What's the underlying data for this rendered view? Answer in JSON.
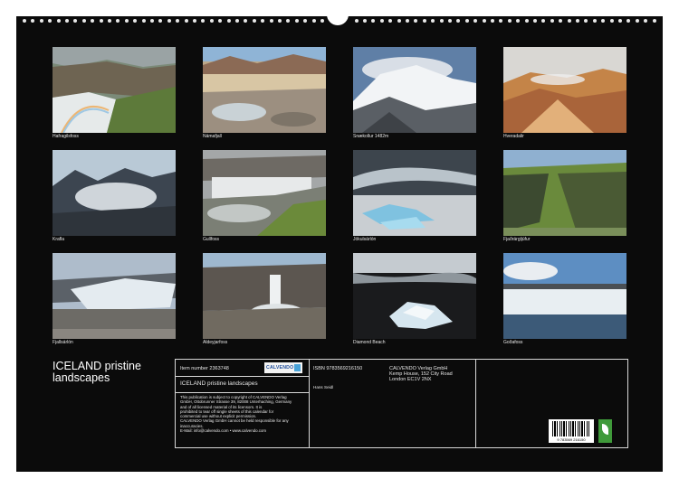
{
  "calendar": {
    "title_line1": "ICELAND pristine",
    "title_line2": "landscapes"
  },
  "photos": [
    {
      "caption": "Hafragilsfoss",
      "scene": "canyon-waterfall-rainbow"
    },
    {
      "caption": "Námafjall",
      "scene": "geothermal-field"
    },
    {
      "caption": "Snækollur 1482m",
      "scene": "snowy-summit"
    },
    {
      "caption": "Hveradalir",
      "scene": "rhyolite-hills"
    },
    {
      "caption": "Krafla",
      "scene": "steaming-mountains"
    },
    {
      "caption": "Gullfoss",
      "scene": "waterfall-gorge"
    },
    {
      "caption": "Jökulsárlón",
      "scene": "glacier-lagoon"
    },
    {
      "caption": "Fjaðrárgljúfur",
      "scene": "green-canyon"
    },
    {
      "caption": "Fjallsárlón",
      "scene": "glacier-tongue"
    },
    {
      "caption": "Aldeyjarfoss",
      "scene": "basalt-waterfall"
    },
    {
      "caption": "Diamond Beach",
      "scene": "ice-on-black-sand"
    },
    {
      "caption": "Goðafoss",
      "scene": "wide-waterfall"
    }
  ],
  "info": {
    "item_label": "Item number 2363748",
    "calvendo_logo": "CALVENDO",
    "product_name": "ICELAND pristine landscapes",
    "notice_lines": [
      "This publication is subject to copyright of CALVENDO Verlag",
      "GmbH, Ottobrunner Strasse 39, 82008 Unterhaching, Germany",
      "and of all licensed material of its licensors. It is",
      "prohibited to tear off single sheets of this calendar for",
      "commercial use without explicit permission.",
      "CALVENDO Verlag GmbH cannot be held responsible for any",
      "inaccuracies.",
      "E-Mail: info@calvendo.com • www.calvendo.com"
    ],
    "isbn": "ISBN 9783569216150",
    "author": "Hans Seidl",
    "publisher_lines": [
      "CALVENDO Verlag GmbH",
      "Kemp House, 152 City Road",
      "London EC1V 2NX"
    ],
    "barcode_number": "9 783569 216150"
  },
  "colors": {
    "sheet": "#0b0b0b",
    "page": "#ffffff",
    "text": "#e6e6e6",
    "rule": "#d8d8d8",
    "eco_label": "#3f9a3a"
  }
}
